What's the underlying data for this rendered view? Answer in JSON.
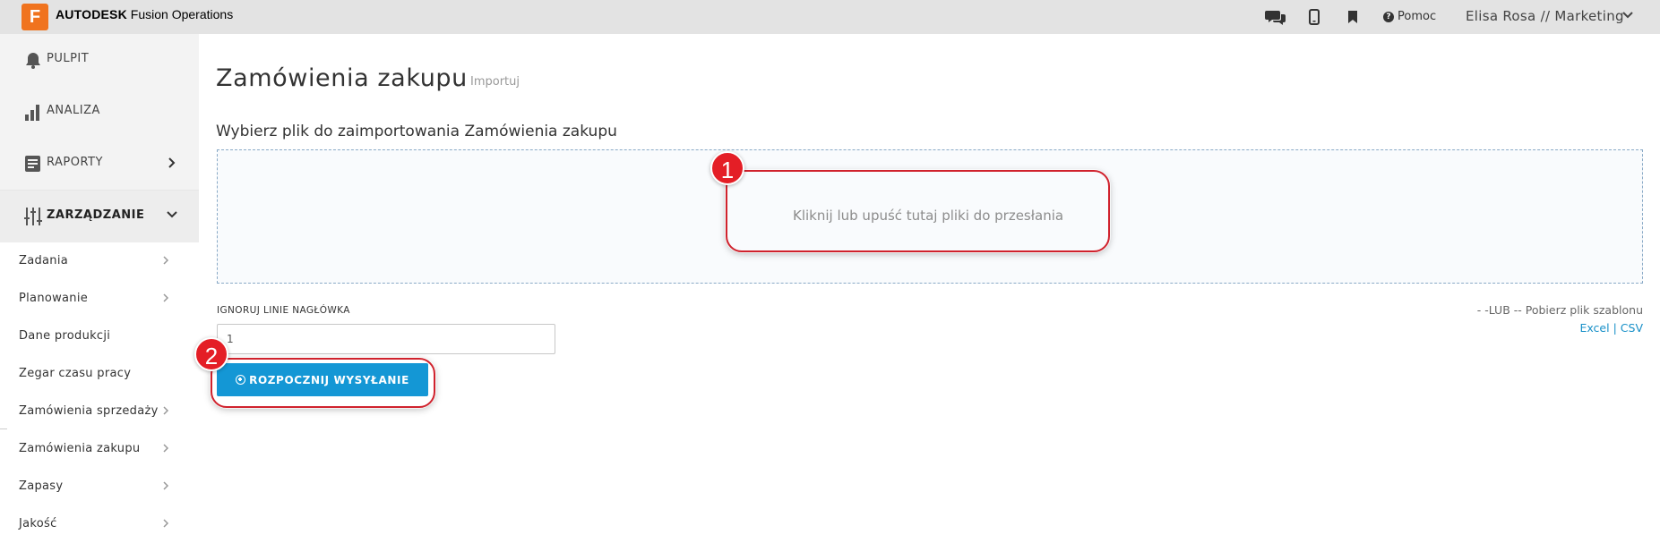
{
  "header": {
    "logo_letter": "F",
    "brand_bold": "AUTODESK",
    "brand_rest": " Fusion Operations",
    "help_label": "Pomoc",
    "user_label": "Elisa Rosa // Marketing"
  },
  "sidebar": {
    "main": [
      {
        "label": "PULPIT",
        "icon": "bell-icon"
      },
      {
        "label": "ANALIZA",
        "icon": "bar-chart-icon"
      },
      {
        "label": "RAPORTY",
        "icon": "report-icon"
      },
      {
        "label": "ZARZĄDZANIE",
        "icon": "sliders-icon"
      }
    ],
    "sub": [
      {
        "label": "Zadania"
      },
      {
        "label": "Planowanie"
      },
      {
        "label": "Dane produkcji"
      },
      {
        "label": "Zegar czasu pracy"
      },
      {
        "label": "Zamówienia sprzedaży"
      },
      {
        "label": "Zamówienia zakupu"
      },
      {
        "label": "Zapasy"
      },
      {
        "label": "Jakość"
      }
    ]
  },
  "main": {
    "title": "Zamówienia zakupu",
    "subtitle": "Importuj",
    "section_title": "Wybierz plik do zaimportowania Zamówienia zakupu",
    "dropzone_text": "Kliknij lub upuść tutaj pliki do przesłania",
    "ignore_label": "IGNORUJ LINIE NAGŁÓWKA",
    "ignore_value": "1",
    "start_button": "ROZPOCZNIJ WYSYŁANIE",
    "template_text": "- -LUB -- Pobierz plik szablonu",
    "link_excel": "Excel",
    "link_sep": "|",
    "link_csv": "CSV"
  },
  "callouts": {
    "one": "1",
    "two": "2"
  },
  "colors": {
    "accent": "#1497d5",
    "callout": "#e41e26",
    "logo": "#f0731e"
  }
}
